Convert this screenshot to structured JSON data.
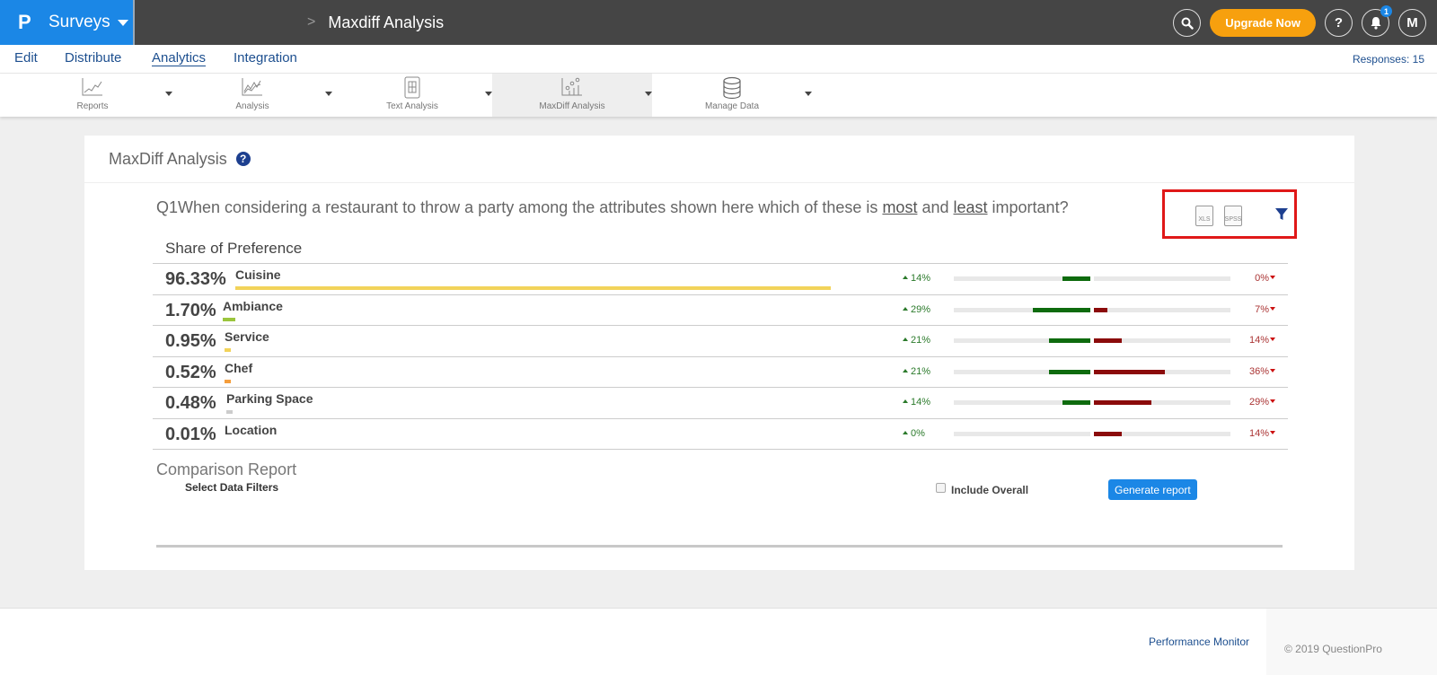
{
  "topbar": {
    "brand_logo": "P",
    "brand_label": "Surveys",
    "breadcrumb_sep": ">",
    "page_title": "Maxdiff Analysis",
    "upgrade_label": "Upgrade Now",
    "help_label": "?",
    "notification_count": "1",
    "avatar_initial": "M"
  },
  "nav": {
    "tabs": [
      {
        "label": "Edit"
      },
      {
        "label": "Distribute"
      },
      {
        "label": "Analytics",
        "active": true
      },
      {
        "label": "Integration"
      }
    ],
    "responses": "Responses: 15"
  },
  "toolbar": {
    "items": [
      {
        "label": "Reports",
        "icon": "line-chart-icon"
      },
      {
        "label": "Analysis",
        "icon": "area-chart-icon"
      },
      {
        "label": "Text Analysis",
        "icon": "text-analysis-icon"
      },
      {
        "label": "MaxDiff Analysis",
        "icon": "scatter-chart-icon",
        "active": true
      },
      {
        "label": "Manage Data",
        "icon": "database-icon"
      }
    ]
  },
  "card": {
    "title": "MaxDiff Analysis",
    "help": "?",
    "question_prefix": "Q1When considering a restaurant to throw a party among the attributes shown here which of these is ",
    "question_most": "most",
    "question_and": " and ",
    "question_least": "least",
    "question_suffix": " important?",
    "export_xls": "XLS",
    "export_spss": "SPSS",
    "share_title": "Share of Preference",
    "colors": {
      "best": "#0e6b0e",
      "worst": "#8b0b0b",
      "track": "#e8e8e8"
    },
    "rows": [
      {
        "share": "96.33%",
        "share_value": 96.33,
        "name": "Cuisine",
        "bar_color": "#f2d35a",
        "best": "14%",
        "best_value": 14,
        "worst": "0%",
        "worst_value": 0
      },
      {
        "share": "1.70%",
        "share_value": 1.7,
        "name": "Ambiance",
        "bar_color": "#9bc53d",
        "best": "29%",
        "best_value": 29,
        "worst": "7%",
        "worst_value": 7
      },
      {
        "share": "0.95%",
        "share_value": 0.95,
        "name": "Service",
        "bar_color": "#f2d35a",
        "best": "21%",
        "best_value": 21,
        "worst": "14%",
        "worst_value": 14
      },
      {
        "share": "0.52%",
        "share_value": 0.52,
        "name": "Chef",
        "bar_color": "#f59e3c",
        "best": "21%",
        "best_value": 21,
        "worst": "36%",
        "worst_value": 36
      },
      {
        "share": "0.48%",
        "share_value": 0.48,
        "name": "Parking Space",
        "bar_color": "#cccccc",
        "best": "14%",
        "best_value": 14,
        "worst": "29%",
        "worst_value": 29
      },
      {
        "share": "0.01%",
        "share_value": 0.01,
        "name": "Location",
        "bar_color": "#cccccc",
        "best": "0%",
        "best_value": 0,
        "worst": "14%",
        "worst_value": 14
      }
    ],
    "comparison_title": "Comparison Report",
    "filters_label": "Select Data Filters",
    "include_overall_label": "Include Overall",
    "include_overall_checked": false,
    "generate_label": "Generate report"
  },
  "footer": {
    "performance_monitor": "Performance Monitor",
    "copyright": "© 2019 QuestionPro"
  }
}
